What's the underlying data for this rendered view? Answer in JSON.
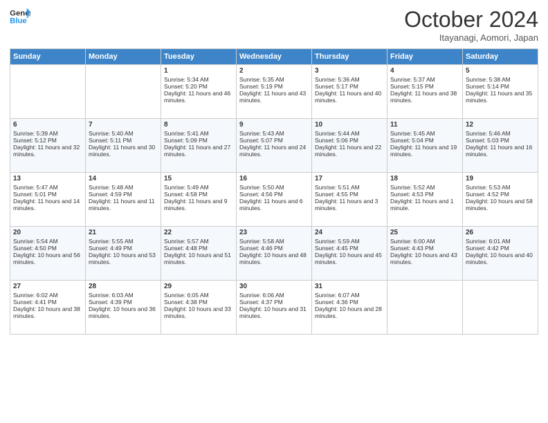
{
  "header": {
    "logo_text_general": "General",
    "logo_text_blue": "Blue",
    "month_title": "October 2024",
    "subtitle": "Itayanagi, Aomori, Japan"
  },
  "days_of_week": [
    "Sunday",
    "Monday",
    "Tuesday",
    "Wednesday",
    "Thursday",
    "Friday",
    "Saturday"
  ],
  "weeks": [
    [
      {
        "day": "",
        "content": ""
      },
      {
        "day": "",
        "content": ""
      },
      {
        "day": "1",
        "content": "Sunrise: 5:34 AM\nSunset: 5:20 PM\nDaylight: 11 hours and 46 minutes."
      },
      {
        "day": "2",
        "content": "Sunrise: 5:35 AM\nSunset: 5:19 PM\nDaylight: 11 hours and 43 minutes."
      },
      {
        "day": "3",
        "content": "Sunrise: 5:36 AM\nSunset: 5:17 PM\nDaylight: 11 hours and 40 minutes."
      },
      {
        "day": "4",
        "content": "Sunrise: 5:37 AM\nSunset: 5:15 PM\nDaylight: 11 hours and 38 minutes."
      },
      {
        "day": "5",
        "content": "Sunrise: 5:38 AM\nSunset: 5:14 PM\nDaylight: 11 hours and 35 minutes."
      }
    ],
    [
      {
        "day": "6",
        "content": "Sunrise: 5:39 AM\nSunset: 5:12 PM\nDaylight: 11 hours and 32 minutes."
      },
      {
        "day": "7",
        "content": "Sunrise: 5:40 AM\nSunset: 5:11 PM\nDaylight: 11 hours and 30 minutes."
      },
      {
        "day": "8",
        "content": "Sunrise: 5:41 AM\nSunset: 5:09 PM\nDaylight: 11 hours and 27 minutes."
      },
      {
        "day": "9",
        "content": "Sunrise: 5:43 AM\nSunset: 5:07 PM\nDaylight: 11 hours and 24 minutes."
      },
      {
        "day": "10",
        "content": "Sunrise: 5:44 AM\nSunset: 5:06 PM\nDaylight: 11 hours and 22 minutes."
      },
      {
        "day": "11",
        "content": "Sunrise: 5:45 AM\nSunset: 5:04 PM\nDaylight: 11 hours and 19 minutes."
      },
      {
        "day": "12",
        "content": "Sunrise: 5:46 AM\nSunset: 5:03 PM\nDaylight: 11 hours and 16 minutes."
      }
    ],
    [
      {
        "day": "13",
        "content": "Sunrise: 5:47 AM\nSunset: 5:01 PM\nDaylight: 11 hours and 14 minutes."
      },
      {
        "day": "14",
        "content": "Sunrise: 5:48 AM\nSunset: 4:59 PM\nDaylight: 11 hours and 11 minutes."
      },
      {
        "day": "15",
        "content": "Sunrise: 5:49 AM\nSunset: 4:58 PM\nDaylight: 11 hours and 9 minutes."
      },
      {
        "day": "16",
        "content": "Sunrise: 5:50 AM\nSunset: 4:56 PM\nDaylight: 11 hours and 6 minutes."
      },
      {
        "day": "17",
        "content": "Sunrise: 5:51 AM\nSunset: 4:55 PM\nDaylight: 11 hours and 3 minutes."
      },
      {
        "day": "18",
        "content": "Sunrise: 5:52 AM\nSunset: 4:53 PM\nDaylight: 11 hours and 1 minute."
      },
      {
        "day": "19",
        "content": "Sunrise: 5:53 AM\nSunset: 4:52 PM\nDaylight: 10 hours and 58 minutes."
      }
    ],
    [
      {
        "day": "20",
        "content": "Sunrise: 5:54 AM\nSunset: 4:50 PM\nDaylight: 10 hours and 56 minutes."
      },
      {
        "day": "21",
        "content": "Sunrise: 5:55 AM\nSunset: 4:49 PM\nDaylight: 10 hours and 53 minutes."
      },
      {
        "day": "22",
        "content": "Sunrise: 5:57 AM\nSunset: 4:48 PM\nDaylight: 10 hours and 51 minutes."
      },
      {
        "day": "23",
        "content": "Sunrise: 5:58 AM\nSunset: 4:46 PM\nDaylight: 10 hours and 48 minutes."
      },
      {
        "day": "24",
        "content": "Sunrise: 5:59 AM\nSunset: 4:45 PM\nDaylight: 10 hours and 45 minutes."
      },
      {
        "day": "25",
        "content": "Sunrise: 6:00 AM\nSunset: 4:43 PM\nDaylight: 10 hours and 43 minutes."
      },
      {
        "day": "26",
        "content": "Sunrise: 6:01 AM\nSunset: 4:42 PM\nDaylight: 10 hours and 40 minutes."
      }
    ],
    [
      {
        "day": "27",
        "content": "Sunrise: 6:02 AM\nSunset: 4:41 PM\nDaylight: 10 hours and 38 minutes."
      },
      {
        "day": "28",
        "content": "Sunrise: 6:03 AM\nSunset: 4:39 PM\nDaylight: 10 hours and 36 minutes."
      },
      {
        "day": "29",
        "content": "Sunrise: 6:05 AM\nSunset: 4:38 PM\nDaylight: 10 hours and 33 minutes."
      },
      {
        "day": "30",
        "content": "Sunrise: 6:06 AM\nSunset: 4:37 PM\nDaylight: 10 hours and 31 minutes."
      },
      {
        "day": "31",
        "content": "Sunrise: 6:07 AM\nSunset: 4:36 PM\nDaylight: 10 hours and 28 minutes."
      },
      {
        "day": "",
        "content": ""
      },
      {
        "day": "",
        "content": ""
      }
    ]
  ]
}
